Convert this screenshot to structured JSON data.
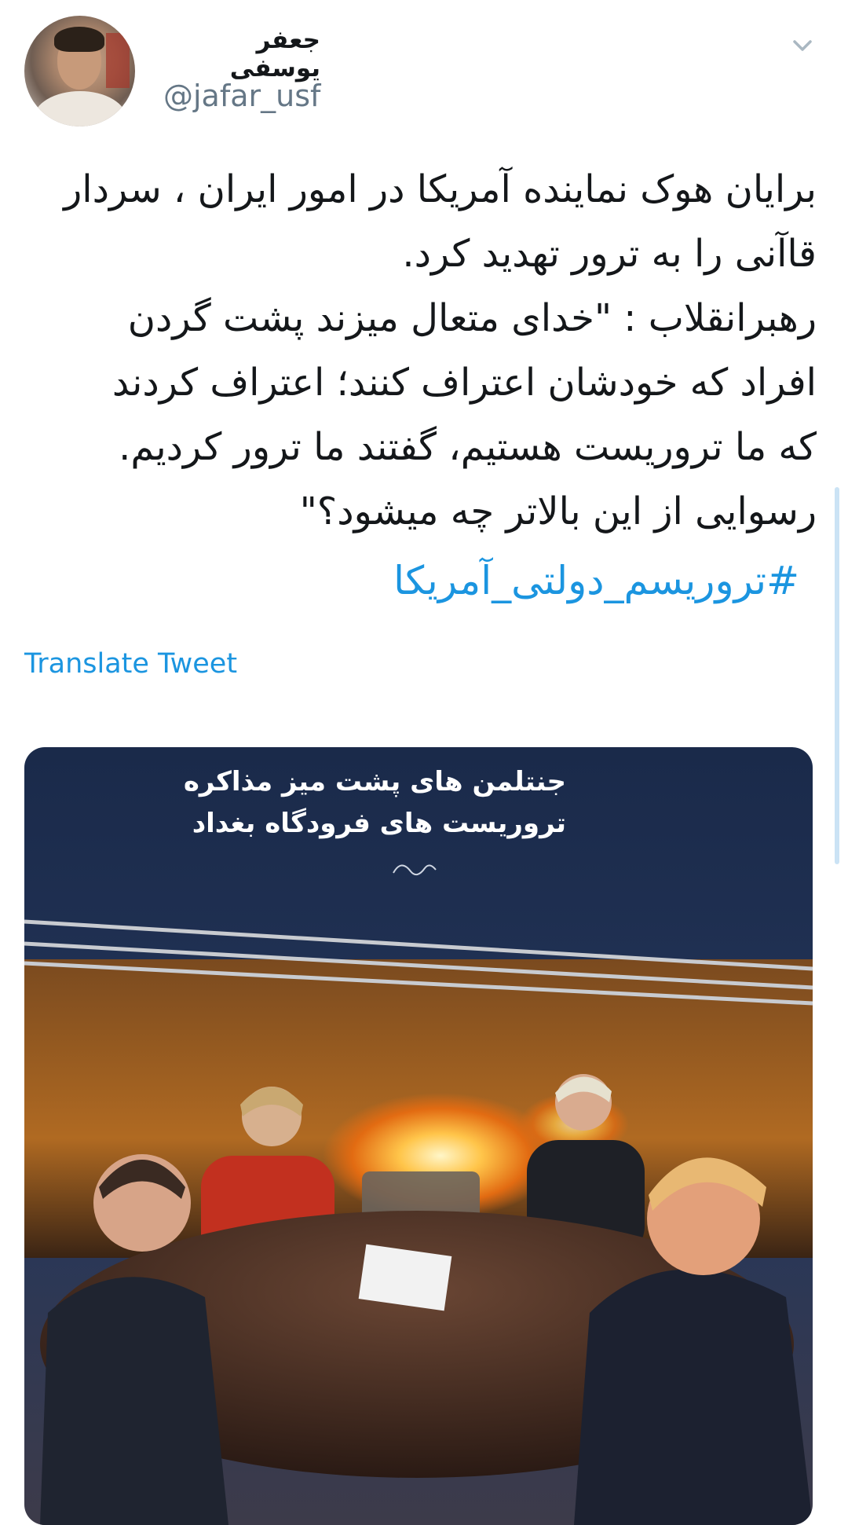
{
  "author": {
    "name": "جعفر یوسفی",
    "handle": "@jafar_usf"
  },
  "tweet": {
    "lines": [
      "برایان هوک نماینده آمریکا در امور ایران ، سردار",
      "قاآنی را به ترور تهدید کرد.",
      "رهبرانقلاب : \"خدای متعال میزند پشت گردن",
      "افراد که خودشان اعتراف کنند؛ اعتراف کردند",
      "که ما تروریست هستیم، گفتند ما ترور کردیم.",
      "رسوایی از این بالاتر چه میشود؟\""
    ],
    "hashtag": "#تروریسم_دولتی_آمریکا",
    "translate_label": "Translate Tweet"
  },
  "media": {
    "caption_line1": "جنتلمن های پشت میز مذاکره",
    "caption_line2": "تروریست های فرودگاه بغداد"
  },
  "icons": {
    "menu": "chevron-down-icon"
  },
  "colors": {
    "link": "#1b95e0",
    "secondary_text": "#657786"
  }
}
